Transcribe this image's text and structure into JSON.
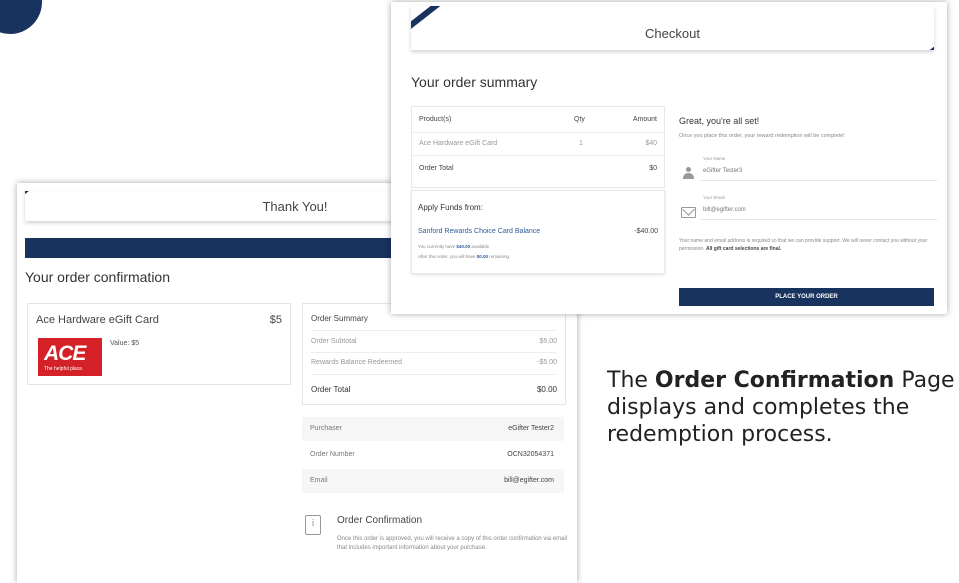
{
  "back_window": {
    "header_title": "Thank You!",
    "section_title": "Your order confirmation",
    "product": {
      "name": "Ace Hardware eGift Card",
      "price": "$5",
      "value_label": "Value: $5",
      "logo_text": "ACE",
      "logo_tagline": "The helpful place."
    },
    "summary": {
      "title": "Order Summary",
      "rows": [
        {
          "label": "Order Subtotal",
          "value": "$5.00"
        },
        {
          "label": "Rewards Balance Redeemed",
          "value": "-$5.00"
        }
      ],
      "total_label": "Order Total",
      "total_value": "$0.00"
    },
    "info": [
      {
        "label": "Purchaser",
        "value": "eGifter Tester2"
      },
      {
        "label": "Order Number",
        "value": "OCN32054371"
      },
      {
        "label": "Email",
        "value": "bill@egifter.com"
      }
    ],
    "confirmation": {
      "title": "Order Confirmation",
      "body": "Once this order is approved, you will receive a copy of this order confirmation via email that includes important information about your purchase."
    }
  },
  "front_window": {
    "header_title": "Checkout",
    "section_title": "Your order summary",
    "table": {
      "headers": {
        "product": "Product(s)",
        "qty": "Qty",
        "amount": "Amount"
      },
      "row": {
        "product": "Ace Hardware eGift Card",
        "qty": "1",
        "amount": "$40"
      },
      "total_label": "Order Total",
      "total_value": "$0"
    },
    "funds": {
      "title": "Apply Funds from:",
      "source": "Sanford Rewards Choice Card Balance",
      "amount": "-$40.00",
      "note1_prefix": "You currently have ",
      "note1_amount": "$40.00",
      "note1_suffix": " available",
      "note2_prefix": "After this order, you will have ",
      "note2_amount": "$0.00",
      "note2_suffix": " remaining"
    },
    "all_set": {
      "title": "Great, you're all set!",
      "subtitle": "Once you place this order, your reward redemption will be complete!"
    },
    "fields": {
      "name_label": "Your Name",
      "name_value": "eGifter Tester3",
      "email_label": "Your Email",
      "email_value": "bill@egifter.com"
    },
    "fine_print_main": "Your name and email address is required so that we can provide support. We will never contact you without your permission. ",
    "fine_print_bold": "All gift card selections are final.",
    "place_order_label": "PLACE YOUR ORDER"
  },
  "caption": {
    "prefix": "The ",
    "bold": "Order Confirmation",
    "rest": " Page displays and completes the redemption process."
  },
  "colors": {
    "brand_navy": "#17335e",
    "ace_red": "#d42027",
    "link_blue": "#2a5d9f"
  }
}
